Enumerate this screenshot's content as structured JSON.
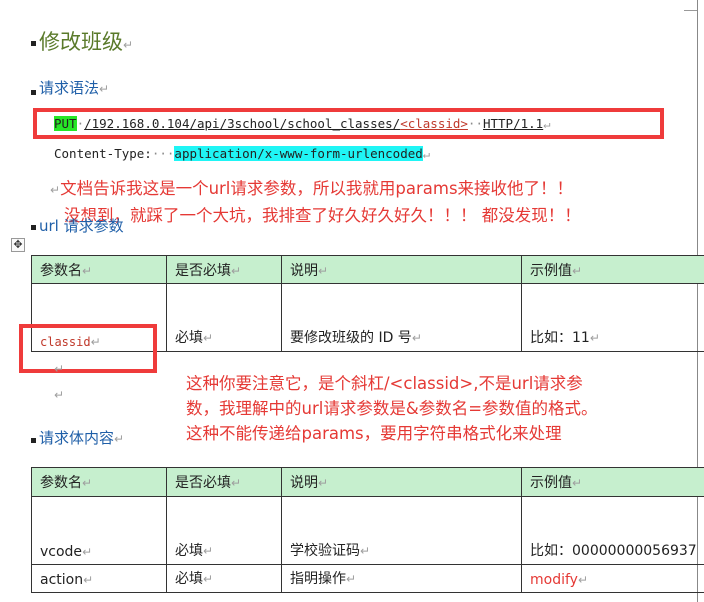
{
  "section_title": "修改班级",
  "request_syntax": {
    "heading": "请求语法",
    "method": "PUT",
    "path": "/192.168.0.104/api/3school/school_classes/",
    "param": "<classid>",
    "dots": "··",
    "protocol": "HTTP/1.1",
    "header_name": "Content-Type:",
    "header_dots": "···",
    "header_value": "application/x-www-form-urlencoded"
  },
  "annotation_1": {
    "line1": "文档告诉我这是一个url请求参数，所以我就用params来接收他了！！",
    "line2": "没想到，就踩了一个大坑，我排查了好久好久好久！！！ 都没发现！！"
  },
  "url_params": {
    "heading": "url 请求参数",
    "columns": [
      "参数名",
      "是否必填",
      "说明",
      "示例值"
    ],
    "rows": [
      [
        "classid",
        "必填",
        "要修改班级的 ID 号",
        "比如：11"
      ]
    ]
  },
  "annotation_2": {
    "line1": "这种你要注意它，是个斜杠/<classid>,不是url请求参",
    "line2": "数，我理解中的url请求参数是&参数名=参数值的格式。",
    "line3": "这种不能传递给params，要用字符串格式化来处理"
  },
  "body_params": {
    "heading": "请求体内容",
    "columns": [
      "参数名",
      "是否必填",
      "说明",
      "示例值"
    ],
    "rows": [
      [
        "vcode",
        "必填",
        "学校验证码",
        "比如：00000000056937"
      ],
      [
        "action",
        "必填",
        "指明操作",
        "modify"
      ]
    ]
  },
  "paragraph_mark": "↵",
  "colors": {
    "heading_green": "#5a7a2a",
    "heading_blue": "#1f5fa8",
    "annotation_red": "#e53935",
    "table_header": "#c6efce",
    "highlight_green": "#27e627",
    "highlight_cyan": "#1ff5f5"
  }
}
